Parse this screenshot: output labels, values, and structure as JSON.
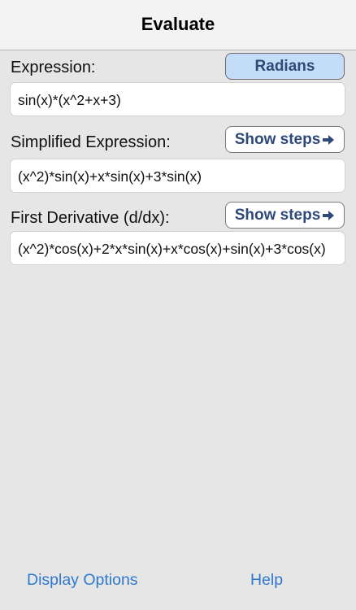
{
  "navbar": {
    "title": "Evaluate"
  },
  "expression": {
    "label": "Expression:",
    "value": "sin(x)*(x^2+x+3)",
    "mode_button": "Radians"
  },
  "simplified": {
    "label": "Simplified Expression:",
    "value": "(x^2)*sin(x)+x*sin(x)+3*sin(x)",
    "steps_button": "Show steps"
  },
  "derivative": {
    "label": "First Derivative (d/dx):",
    "value": "(x^2)*cos(x)+2*x*sin(x)+x*cos(x)+sin(x)+3*cos(x)",
    "steps_button": "Show steps"
  },
  "footer": {
    "display_options": "Display Options",
    "help": "Help"
  },
  "colors": {
    "accent": "#2f78cf",
    "button_text": "#2e4a7a",
    "radians_fill": "#c3ddf8"
  },
  "icons": {
    "steps_arrow": "right-arrow-icon"
  }
}
